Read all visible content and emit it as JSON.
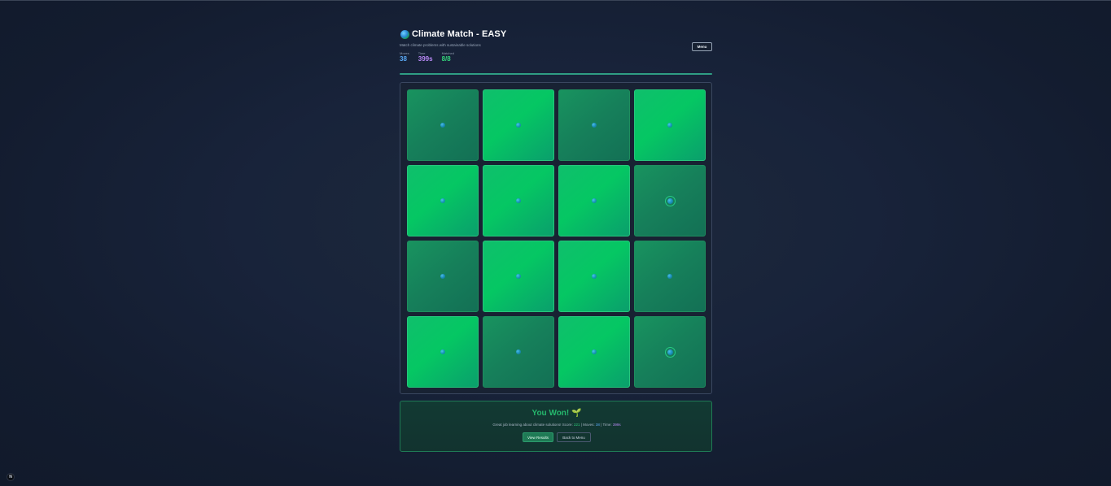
{
  "header": {
    "title": "Climate Match - EASY",
    "title_icon": "globe-icon",
    "subtitle": "Match climate problems with sustainable solutions",
    "menu_label": "Menu"
  },
  "stats": {
    "moves_label": "Moves",
    "moves_value": "38",
    "time_label": "Time",
    "time_value": "399s",
    "matched_label": "Matched",
    "matched_value": "8/8"
  },
  "progress": {
    "fraction": 1.0
  },
  "board": {
    "rows": 4,
    "cols": 4,
    "cards": [
      {
        "style": "dim",
        "icon": "orb"
      },
      {
        "style": "bright",
        "icon": "orb"
      },
      {
        "style": "dim",
        "icon": "orb"
      },
      {
        "style": "bright",
        "icon": "orb"
      },
      {
        "style": "bright",
        "icon": "orb"
      },
      {
        "style": "bright",
        "icon": "orb"
      },
      {
        "style": "bright",
        "icon": "orb"
      },
      {
        "style": "dim",
        "icon": "orb-ring"
      },
      {
        "style": "dim",
        "icon": "orb"
      },
      {
        "style": "bright",
        "icon": "orb"
      },
      {
        "style": "bright",
        "icon": "orb"
      },
      {
        "style": "dim",
        "icon": "orb"
      },
      {
        "style": "bright",
        "icon": "orb"
      },
      {
        "style": "dim",
        "icon": "orb"
      },
      {
        "style": "bright",
        "icon": "orb"
      },
      {
        "style": "dim",
        "icon": "orb-ring"
      }
    ]
  },
  "win": {
    "title": "You Won! 🌱",
    "text_prefix": "Great job learning about climate solutions! Score: ",
    "score": "221",
    "moves_prefix": " | Moves: ",
    "moves": "38",
    "time_prefix": " | Time: ",
    "time": "399s",
    "view_results_label": "View Results",
    "back_label": "Back to Menu"
  },
  "corner_badge": "N",
  "colors": {
    "accent_green": "#25b86d",
    "moves_blue": "#5aa9f5",
    "time_purple": "#b889f5"
  }
}
